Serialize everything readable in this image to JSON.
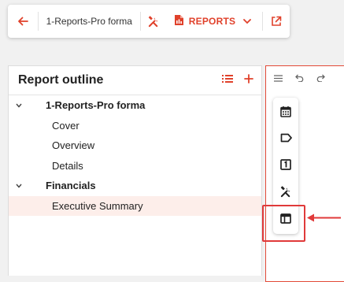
{
  "toolbar": {
    "document_title": "1-Reports-Pro forma",
    "reports_label": "REPORTS",
    "icons": [
      "back-arrow-icon",
      "tools-icon",
      "report-document-icon",
      "chevron-down-icon",
      "share-icon"
    ]
  },
  "outline": {
    "title": "Report outline",
    "actions": [
      "list-icon",
      "plus-icon"
    ],
    "tree": [
      {
        "label": "1-Reports-Pro forma",
        "expanded": true,
        "children": [
          "Cover",
          "Overview",
          "Details"
        ]
      },
      {
        "label": "Financials",
        "expanded": true,
        "children": [
          "Executive Summary"
        ],
        "selected_child": "Executive Summary"
      }
    ]
  },
  "canvas": {
    "toolbar_icons": [
      "menu-icon",
      "undo-icon",
      "redo-icon"
    ],
    "palette_icons": [
      "calendar-icon",
      "tag-icon",
      "number-one-icon",
      "tools-icon",
      "table-layout-icon"
    ],
    "highlighted_icon": "table-layout-icon"
  },
  "colors": {
    "accent": "#e0412b",
    "highlight": "#e03a3a",
    "selected_row": "#fdeeea"
  }
}
